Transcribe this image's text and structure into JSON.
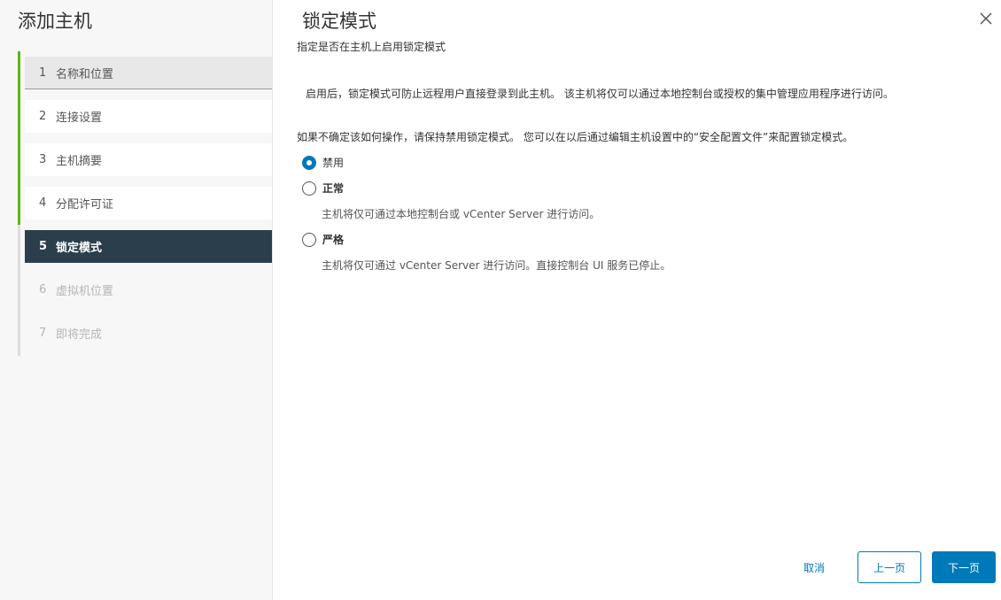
{
  "wizard": {
    "title": "添加主机"
  },
  "steps": [
    {
      "num": "1",
      "label": "名称和位置",
      "state": "done"
    },
    {
      "num": "2",
      "label": "连接设置",
      "state": "done"
    },
    {
      "num": "3",
      "label": "主机摘要",
      "state": "done"
    },
    {
      "num": "4",
      "label": "分配许可证",
      "state": "done"
    },
    {
      "num": "5",
      "label": "锁定模式",
      "state": "current"
    },
    {
      "num": "6",
      "label": "虚拟机位置",
      "state": "todo"
    },
    {
      "num": "7",
      "label": "即将完成",
      "state": "todo"
    }
  ],
  "page": {
    "title": "锁定模式",
    "subtitle": "指定是否在主机上启用锁定模式",
    "para1": "启用后，锁定模式可防止远程用户直接登录到此主机。 该主机将仅可以通过本地控制台或授权的集中管理应用程序进行访问。",
    "para2": "如果不确定该如何操作，请保持禁用锁定模式。 您可以在以后通过编辑主机设置中的“安全配置文件”来配置锁定模式。"
  },
  "options": [
    {
      "label": "禁用",
      "checked": true,
      "desc": ""
    },
    {
      "label": "正常",
      "checked": false,
      "desc": "主机将仅可通过本地控制台或 vCenter Server 进行访问。"
    },
    {
      "label": "严格",
      "checked": false,
      "desc": "主机将仅可通过 vCenter Server 进行访问。直接控制台 UI 服务已停止。"
    }
  ],
  "buttons": {
    "cancel": "取消",
    "back": "上一页",
    "next": "下一页"
  },
  "colors": {
    "accent": "#0079b8",
    "done_rail": "#60b515",
    "current_step_bg": "#2b3e4c"
  }
}
